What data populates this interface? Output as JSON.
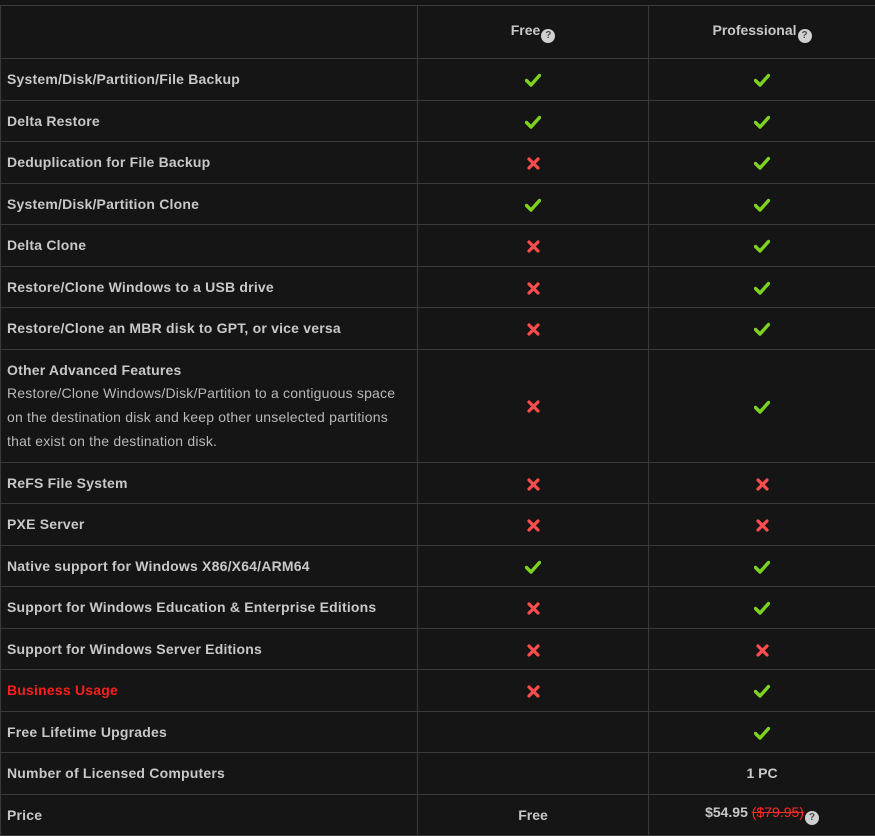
{
  "header": {
    "col_free": "Free",
    "col_pro": "Professional",
    "help_glyph": "?"
  },
  "colors": {
    "check": "#7ed321",
    "cross": "#ff4d4d",
    "highlight": "#ff1e1e"
  },
  "rows": [
    {
      "feature": "System/Disk/Partition/File Backup",
      "free": "check",
      "pro": "check"
    },
    {
      "feature": "Delta Restore",
      "free": "check",
      "pro": "check"
    },
    {
      "feature": "Deduplication for File Backup",
      "free": "cross",
      "pro": "check"
    },
    {
      "feature": "System/Disk/Partition Clone",
      "free": "check",
      "pro": "check"
    },
    {
      "feature": "Delta Clone",
      "free": "cross",
      "pro": "check"
    },
    {
      "feature": "Restore/Clone Windows to a USB drive",
      "free": "cross",
      "pro": "check"
    },
    {
      "feature": "Restore/Clone an MBR disk to GPT, or vice versa",
      "free": "cross",
      "pro": "check"
    },
    {
      "feature": "Other Advanced Features",
      "description": "Restore/Clone Windows/Disk/Partition to a contiguous space on the destination disk and keep other unselected partitions that exist on the destination disk.",
      "free": "cross",
      "pro": "check"
    },
    {
      "feature": "ReFS File System",
      "free": "cross",
      "pro": "cross"
    },
    {
      "feature": "PXE Server",
      "free": "cross",
      "pro": "cross"
    },
    {
      "feature": "Native support for Windows X86/X64/ARM64",
      "free": "check",
      "pro": "check"
    },
    {
      "feature": "Support for Windows Education & Enterprise Editions",
      "free": "cross",
      "pro": "check"
    },
    {
      "feature": "Support for Windows Server Editions",
      "free": "cross",
      "pro": "cross"
    },
    {
      "feature": "Business Usage",
      "highlight": true,
      "free": "cross",
      "pro": "check"
    },
    {
      "feature": "Free Lifetime Upgrades",
      "free": "",
      "pro": "check"
    },
    {
      "feature": "Number of Licensed Computers",
      "free": "",
      "pro_text": "1 PC"
    }
  ],
  "price": {
    "label": "Price",
    "free": "Free",
    "pro": "$54.95",
    "pro_original": "($79.95)"
  }
}
